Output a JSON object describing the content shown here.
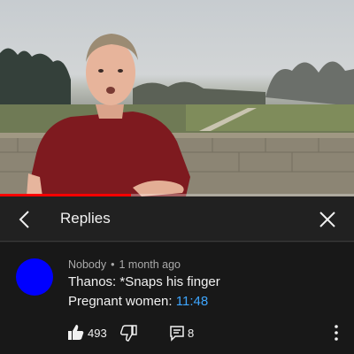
{
  "video": {
    "progress": 0.37,
    "progress_color": "#ff0000"
  },
  "header": {
    "back_icon": "chevron-left-icon",
    "title": "Replies",
    "close_icon": "close-icon"
  },
  "comment": {
    "avatar_color": "#0000ff",
    "author": "Nobody",
    "separator": "•",
    "time_ago": "1 month ago",
    "line1": "Thanos: *Snaps his finger",
    "line2_prefix": "Pregnant women: ",
    "timestamp": "11:48",
    "timestamp_color": "#3ea6ff",
    "like_count": "493",
    "reply_count": "8",
    "icons": [
      "thumbs-up-icon",
      "thumbs-down-icon",
      "reply-icon",
      "more-vertical-icon"
    ]
  }
}
